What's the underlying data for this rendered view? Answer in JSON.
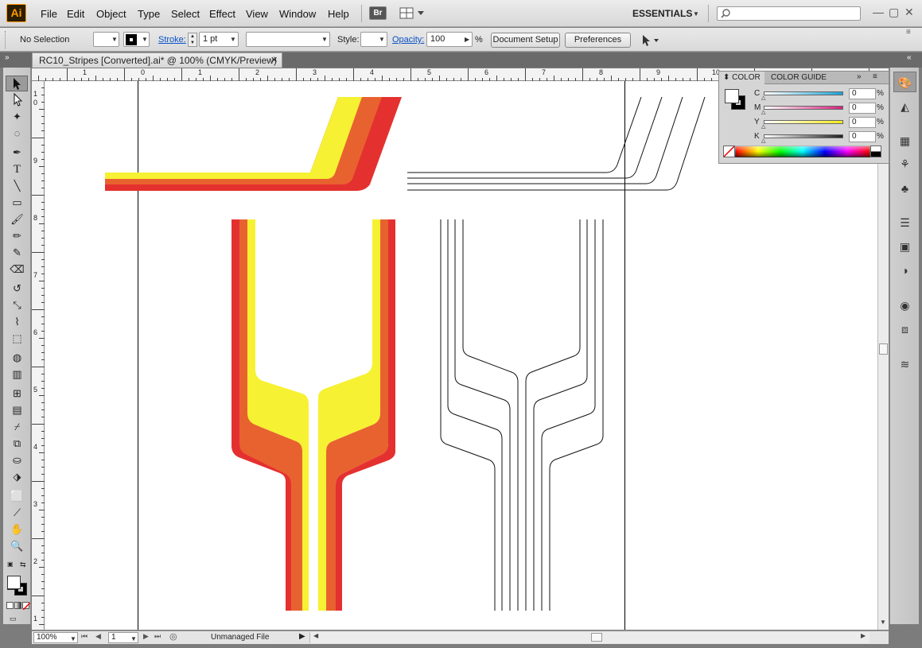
{
  "app": {
    "logo": "Ai"
  },
  "menu": [
    "File",
    "Edit",
    "Object",
    "Type",
    "Select",
    "Effect",
    "View",
    "Window",
    "Help"
  ],
  "bridge_label": "Br",
  "workspace": "ESSENTIALS",
  "control": {
    "selection": "No Selection",
    "stroke_label": "Stroke:",
    "stroke_value": "1 pt",
    "style_label": "Style:",
    "opacity_label": "Opacity:",
    "opacity_value": "100",
    "percent": "%",
    "document_setup": "Document Setup",
    "preferences": "Preferences"
  },
  "document": {
    "tab_title": "RC10_Stripes [Converted].ai* @ 100% (CMYK/Preview)",
    "close": "✕"
  },
  "ruler": {
    "h": [
      "1",
      "0",
      "1",
      "2",
      "3",
      "4",
      "5",
      "6",
      "7",
      "8",
      "9",
      "10"
    ],
    "v": [
      "1",
      "0",
      "9",
      "8",
      "7",
      "6",
      "5",
      "4",
      "3",
      "2",
      "1"
    ]
  },
  "color_panel": {
    "tabs": [
      "COLOR",
      "COLOR GUIDE"
    ],
    "channels": [
      {
        "label": "C",
        "value": "0",
        "unit": "%",
        "color": "#1aa3d8"
      },
      {
        "label": "M",
        "value": "0",
        "unit": "%",
        "color": "#d6207f"
      },
      {
        "label": "Y",
        "value": "0",
        "unit": "%",
        "color": "#f5eb1a"
      },
      {
        "label": "K",
        "value": "0",
        "unit": "%",
        "color": "#222222"
      }
    ]
  },
  "status": {
    "zoom": "100%",
    "page": "1",
    "info": "Unmanaged File"
  },
  "colors": {
    "yellow": "#f6f132",
    "orange": "#e8622f",
    "red": "#e4312f"
  }
}
